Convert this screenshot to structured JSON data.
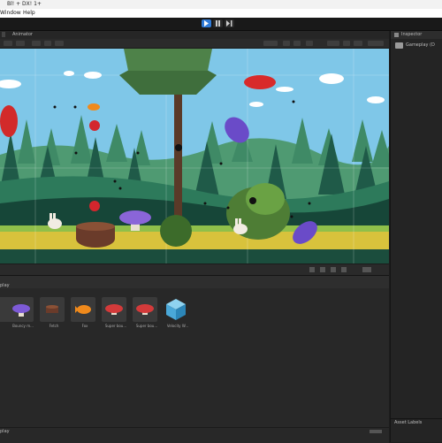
{
  "titlebar": {
    "title": "Bl! + DX! 1+"
  },
  "menubar": {
    "items": [
      "Window",
      "Help"
    ]
  },
  "scene_panel": {
    "tab_label": "Animator"
  },
  "inspector": {
    "tab_label": "Inspector",
    "item_label": "Gameplay (D"
  },
  "display_panel": {
    "tab_label": "play",
    "assets": [
      {
        "label": "",
        "icon": "partial-asset-icon"
      },
      {
        "label": "Bouncy m...",
        "icon": "purple-mushroom-icon"
      },
      {
        "label": "Fetch",
        "icon": "stump-icon"
      },
      {
        "label": "Fox",
        "icon": "fish-icon"
      },
      {
        "label": "Super bou...",
        "icon": "red-mushroom-icon"
      },
      {
        "label": "Super bou...",
        "icon": "red-mushroom-icon"
      },
      {
        "label": "Velocity W...",
        "icon": "cube-icon"
      }
    ],
    "footer_label": "play"
  },
  "footer": {
    "asset_labels": "Asset Labels"
  },
  "colors": {
    "sky": "#7fc7e8",
    "ground": "#d8c23c",
    "accent_blue": "#2f7bd8"
  }
}
